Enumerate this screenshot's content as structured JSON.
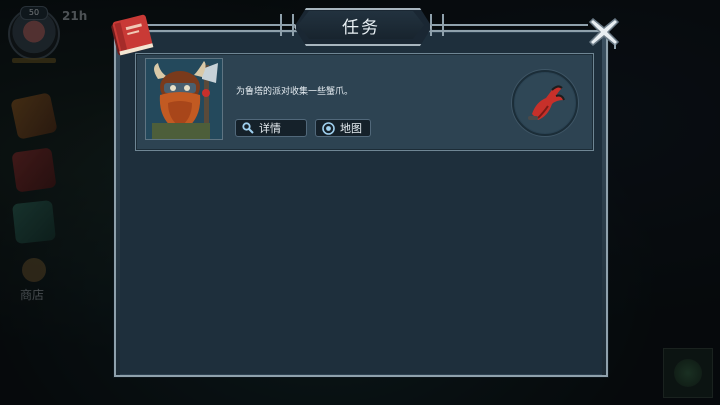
{
  "hud": {
    "level": "50",
    "time": "21h",
    "shop_label": "商店"
  },
  "dialog": {
    "title": "任务",
    "accent_color": "#8fa1ac"
  },
  "quest": {
    "description": "为鲁塔的派对收集一些蟹爪。",
    "details_label": "详情",
    "map_label": "地图",
    "portrait": "dwarf-quest-giver",
    "item": "crab-claw"
  }
}
